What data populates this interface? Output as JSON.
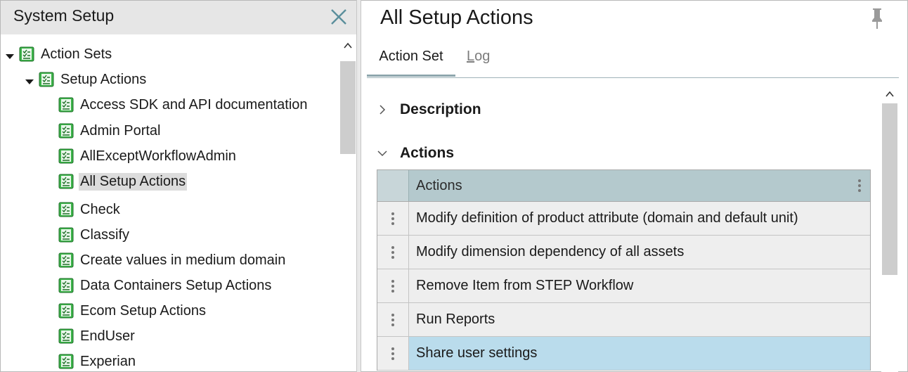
{
  "left_panel": {
    "title": "System Setup",
    "tree": [
      {
        "label": "Action Sets",
        "expanded": true,
        "level": 0
      },
      {
        "label": "Setup Actions",
        "expanded": true,
        "level": 1
      },
      {
        "label": "Access SDK and API documentation",
        "level": 2
      },
      {
        "label": "Admin Portal",
        "level": 2
      },
      {
        "label": "AllExceptWorkflowAdmin",
        "level": 2
      },
      {
        "label": "All Setup Actions",
        "level": 2,
        "selected": true
      },
      {
        "label": "Check",
        "level": 2
      },
      {
        "label": "Classify",
        "level": 2
      },
      {
        "label": "Create values in medium domain",
        "level": 2
      },
      {
        "label": "Data Containers Setup Actions",
        "level": 2
      },
      {
        "label": "Ecom Setup Actions",
        "level": 2
      },
      {
        "label": "EndUser",
        "level": 2
      },
      {
        "label": "Experian",
        "level": 2
      }
    ]
  },
  "right_panel": {
    "title": "All Setup Actions",
    "tabs": [
      {
        "label": "Action Set",
        "active": true
      },
      {
        "label": "Log",
        "active": false,
        "mnemonic": "L",
        "rest": "og"
      }
    ],
    "sections": {
      "description": {
        "label": "Description",
        "expanded": false
      },
      "actions": {
        "label": "Actions",
        "expanded": true
      }
    },
    "grid": {
      "column_header": "Actions",
      "rows": [
        "Modify definition of product attribute (domain and default unit)",
        "Modify dimension dependency of all assets",
        "Remove Item from STEP Workflow",
        "Run Reports",
        "Share user settings"
      ],
      "highlighted_row": 4
    }
  },
  "colors": {
    "header_bg": "#e6e6e6",
    "grid_header_bg": "#b4c9cd",
    "row_bg": "#eeeeee",
    "row_highlight": "#badcec",
    "tab_indicator": "#8ea6ad",
    "tree_icon_green": "#3cb44a"
  }
}
